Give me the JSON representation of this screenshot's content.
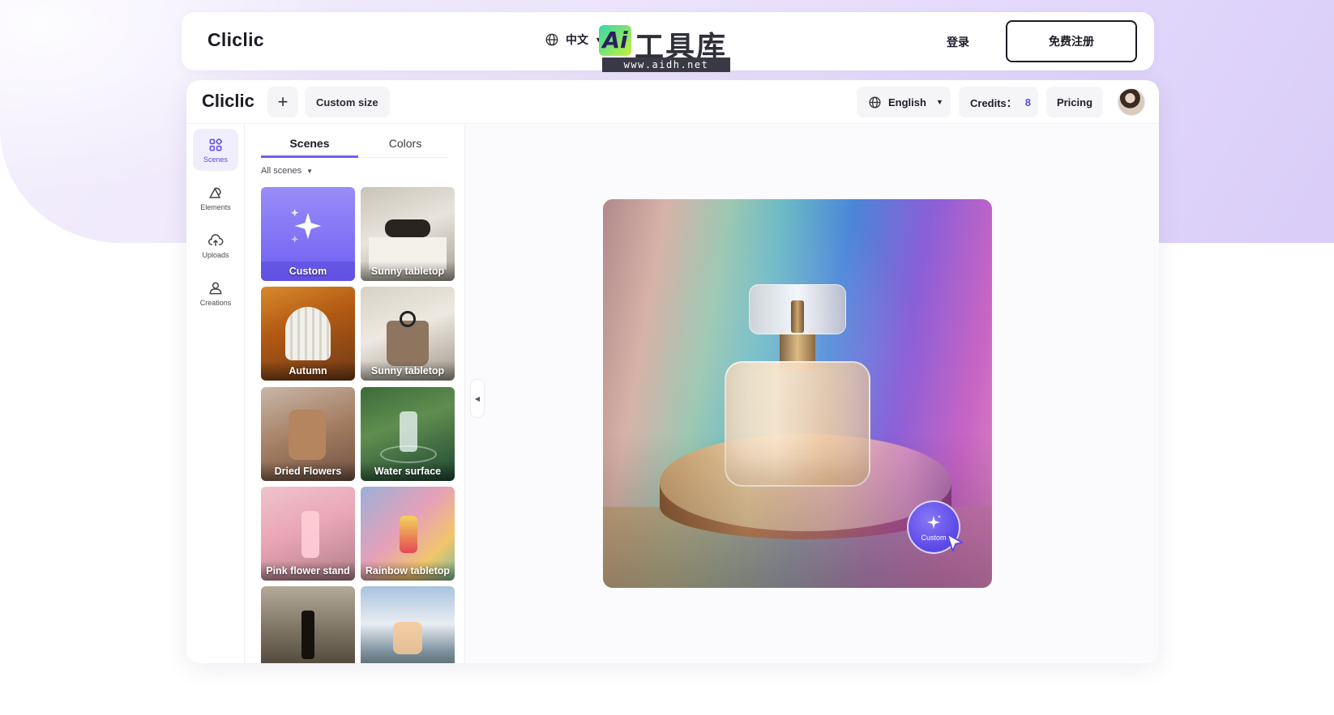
{
  "topbar": {
    "brand": "Cliclic",
    "language": "中文",
    "watermark_ai": "Ai",
    "watermark_text": "工具库",
    "watermark_url": "www.aidh.net",
    "login": "登录",
    "signup": "免费注册"
  },
  "app": {
    "brand": "Cliclic",
    "add_icon": "plus-icon",
    "custom_size": "Custom size",
    "language": "English",
    "credits_label": "Credits：",
    "credits_value": "8",
    "pricing": "Pricing"
  },
  "rail": {
    "items": [
      {
        "label": "Scenes",
        "icon": "grid-icon",
        "active": true
      },
      {
        "label": "Elements",
        "icon": "shapes-icon",
        "active": false
      },
      {
        "label": "Uploads",
        "icon": "cloud-upload-icon",
        "active": false
      },
      {
        "label": "Creations",
        "icon": "user-icon",
        "active": false
      }
    ]
  },
  "panel": {
    "tabs": [
      {
        "label": "Scenes",
        "active": true
      },
      {
        "label": "Colors",
        "active": false
      }
    ],
    "filter": "All scenes",
    "scenes": [
      {
        "label": "Custom"
      },
      {
        "label": "Sunny tabletop"
      },
      {
        "label": "Autumn"
      },
      {
        "label": "Sunny tabletop"
      },
      {
        "label": "Dried Flowers"
      },
      {
        "label": "Water surface"
      },
      {
        "label": "Pink flower stand"
      },
      {
        "label": "Rainbow tabletop"
      },
      {
        "label": ""
      },
      {
        "label": ""
      }
    ]
  },
  "canvas": {
    "fab_label": "Custom"
  },
  "colors": {
    "accent": "#6c5ff0",
    "credits": "#5b4ee8"
  }
}
